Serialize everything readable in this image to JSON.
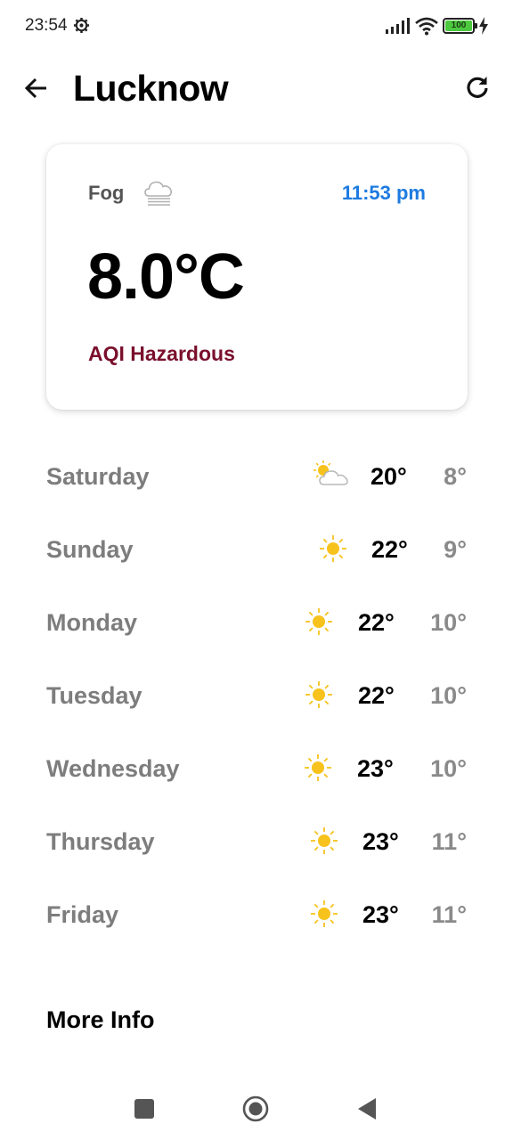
{
  "status_bar": {
    "time": "23:54",
    "battery": "100"
  },
  "app_bar": {
    "title": "Lucknow"
  },
  "current": {
    "condition": "Fog",
    "condition_icon": "fog-icon",
    "time": "11:53 pm",
    "temperature": "8.0°C",
    "aqi": "AQI Hazardous"
  },
  "forecast": [
    {
      "day": "Saturday",
      "icon": "partly-sunny-icon",
      "high": "20°",
      "low": "8°"
    },
    {
      "day": "Sunday",
      "icon": "sun-icon",
      "high": "22°",
      "low": "9°"
    },
    {
      "day": "Monday",
      "icon": "sun-icon",
      "high": "22°",
      "low": "10°"
    },
    {
      "day": "Tuesday",
      "icon": "sun-icon",
      "high": "22°",
      "low": "10°"
    },
    {
      "day": "Wednesday",
      "icon": "sun-icon",
      "high": "23°",
      "low": "10°"
    },
    {
      "day": "Thursday",
      "icon": "sun-icon",
      "high": "23°",
      "low": "11°"
    },
    {
      "day": "Friday",
      "icon": "sun-icon",
      "high": "23°",
      "low": "11°"
    }
  ],
  "more_info_label": "More Info",
  "colors": {
    "accent_time": "#1e7be0",
    "aqi_hazardous": "#7a0f2c",
    "sun": "#f7c21c"
  }
}
